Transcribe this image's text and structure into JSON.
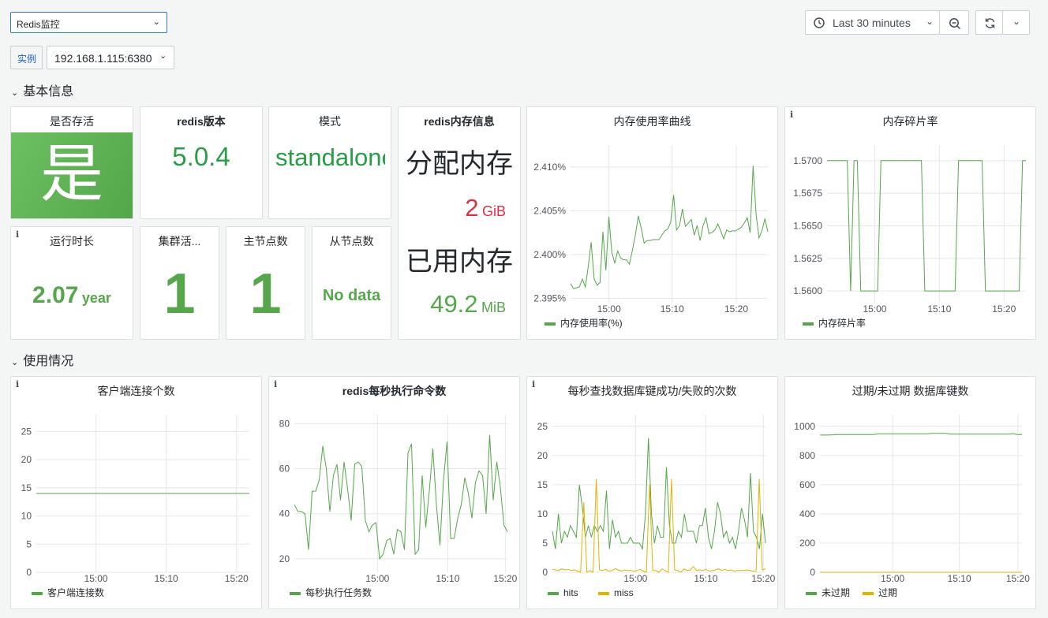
{
  "header": {
    "dashboard_select": "Redis监控",
    "var_label": "实例",
    "var_value": "192.168.1.115:6380",
    "time_range": "Last 30 minutes"
  },
  "rows": {
    "basic": "基本信息",
    "usage": "使用情况"
  },
  "stats": {
    "alive": {
      "title": "是否存活",
      "value": "是"
    },
    "version": {
      "title": "redis版本",
      "value": "5.0.4"
    },
    "mode": {
      "title": "模式",
      "value": "standalone"
    },
    "mem": {
      "title": "redis内存信息",
      "alloc_label": "分配内存",
      "alloc_value": "2",
      "alloc_unit": "GiB",
      "used_label": "已用内存",
      "used_value": "49.2",
      "used_unit": "MiB"
    },
    "uptime": {
      "title": "运行时长",
      "value": "2.07",
      "unit": "year"
    },
    "cluster": {
      "title": "集群活...",
      "value": "1"
    },
    "masters": {
      "title": "主节点数",
      "value": "1"
    },
    "slaves": {
      "title": "从节点数",
      "value": "No data"
    }
  },
  "colors": {
    "green": "#56a64b",
    "yellow": "#e0b400",
    "red": "#e02f44",
    "stat_green": "#299c46"
  },
  "chart_data": [
    {
      "id": "mem_usage",
      "type": "line",
      "title": "内存使用率曲线",
      "x_ticks": [
        "15:00",
        "15:10",
        "15:20"
      ],
      "y_ticks": [
        "2.395%",
        "2.400%",
        "2.405%",
        "2.410%"
      ],
      "ylim": [
        2.3945,
        2.4125
      ],
      "series": [
        {
          "name": "内存使用率(%)",
          "color": "#56a64b",
          "values": [
            2.3967,
            2.3961,
            2.3962,
            2.3963,
            2.3972,
            2.3963,
            2.3986,
            2.4014,
            2.3972,
            2.3965,
            2.3968,
            2.4026,
            2.3982,
            2.4043,
            2.4003,
            2.399,
            2.4004,
            2.3996,
            2.3994,
            2.3994,
            2.3989,
            2.4005,
            2.4022,
            2.4044,
            2.403,
            2.4013,
            2.4016,
            2.4016,
            2.4017,
            2.4017,
            2.4017,
            2.4022,
            2.4027,
            2.4029,
            2.4037,
            2.4068,
            2.4028,
            2.4033,
            2.4052,
            2.4032,
            2.4036,
            2.404,
            2.4022,
            2.4033,
            2.4016,
            2.4033,
            2.4042,
            2.4024,
            2.4025,
            2.4028,
            2.4035,
            2.4027,
            2.4018,
            2.4028,
            2.4026,
            2.4027,
            2.4027,
            2.4029,
            2.4031,
            2.4036,
            2.4042,
            2.4025,
            2.4101,
            2.4046,
            2.4019,
            2.4027,
            2.4041,
            2.4026
          ]
        }
      ]
    },
    {
      "id": "frag",
      "type": "line",
      "title": "内存碎片率",
      "x_ticks": [
        "15:00",
        "15:10",
        "15:20"
      ],
      "y_ticks": [
        "1.5600",
        "1.5625",
        "1.5650",
        "1.5675",
        "1.5700"
      ],
      "ylim": [
        1.5591,
        1.5712
      ],
      "series": [
        {
          "name": "内存碎片率",
          "color": "#56a64b",
          "values": [
            1.57,
            1.57,
            1.57,
            1.57,
            1.57,
            1.57,
            1.57,
            1.56,
            1.57,
            1.57,
            1.56,
            1.56,
            1.56,
            1.56,
            1.56,
            1.56,
            1.57,
            1.57,
            1.57,
            1.57,
            1.57,
            1.57,
            1.57,
            1.57,
            1.57,
            1.57,
            1.57,
            1.57,
            1.57,
            1.56,
            1.56,
            1.56,
            1.56,
            1.56,
            1.56,
            1.56,
            1.56,
            1.56,
            1.56,
            1.57,
            1.57,
            1.57,
            1.57,
            1.57,
            1.57,
            1.57,
            1.57,
            1.56,
            1.56,
            1.56,
            1.56,
            1.56,
            1.56,
            1.56,
            1.56,
            1.56,
            1.56,
            1.56,
            1.57,
            1.57
          ]
        }
      ]
    },
    {
      "id": "clients",
      "type": "line",
      "title": "客户端连接个数",
      "x_ticks": [
        "15:00",
        "15:10",
        "15:20"
      ],
      "y_ticks": [
        "0",
        "5",
        "10",
        "15",
        "20",
        "25"
      ],
      "ylim": [
        0,
        28
      ],
      "series": [
        {
          "name": "客户端连接数",
          "color": "#56a64b",
          "values": [
            14,
            14
          ]
        }
      ]
    },
    {
      "id": "ops",
      "type": "line",
      "title": "redis每秒执行命令数",
      "x_ticks": [
        "15:00",
        "15:10",
        "15:20"
      ],
      "y_ticks": [
        "20",
        "40",
        "60",
        "80"
      ],
      "ylim": [
        14,
        84
      ],
      "series": [
        {
          "name": "每秒执行任务数",
          "color": "#56a64b",
          "values": [
            44,
            41,
            41,
            40,
            24,
            50,
            50,
            55,
            70,
            60,
            41,
            57,
            62,
            46,
            63,
            51,
            37,
            62,
            63,
            61,
            37,
            32,
            35,
            36,
            20,
            22,
            28,
            29,
            22,
            33,
            32,
            24,
            67,
            71,
            22,
            24,
            57,
            34,
            50,
            69,
            44,
            26,
            55,
            72,
            29,
            29,
            38,
            44,
            56,
            49,
            38,
            54,
            59,
            57,
            40,
            75,
            46,
            63,
            52,
            35,
            32
          ]
        }
      ]
    },
    {
      "id": "hits",
      "type": "line",
      "title": "每秒查找数据库键成功/失败的次数",
      "x_ticks": [
        "15:00",
        "15:10",
        "15:20"
      ],
      "y_ticks": [
        "0",
        "5",
        "10",
        "15",
        "20",
        "25"
      ],
      "ylim": [
        0,
        27
      ],
      "series": [
        {
          "name": "hits",
          "color": "#56a64b",
          "values": [
            7,
            4,
            10,
            5,
            7,
            6,
            8,
            7,
            6,
            15,
            11,
            6,
            8,
            6,
            8,
            7,
            8,
            7,
            14,
            4,
            9,
            6,
            7,
            5,
            5,
            5,
            6,
            5,
            5,
            5,
            4,
            10,
            23,
            10,
            5,
            8,
            6,
            6,
            18,
            8,
            5,
            5,
            7,
            6,
            10,
            7,
            7,
            7,
            5,
            8,
            8,
            11,
            6,
            4,
            7,
            12,
            10,
            6,
            7,
            5,
            6,
            4,
            7,
            11,
            9,
            6,
            17,
            7,
            6,
            4,
            10,
            5
          ]
        },
        {
          "name": "miss",
          "color": "#e0b400",
          "values": [
            0.5,
            0.4,
            0.3,
            0.6,
            0.4,
            0.5,
            0.3,
            0.4,
            0.2,
            0,
            12,
            0,
            0.3,
            0,
            16,
            0.4,
            0.3,
            0.5,
            0.2,
            0.3,
            0.6,
            0.4,
            0.2,
            0.4,
            0.3,
            0.3,
            0.2,
            0.3,
            0.5,
            0.2,
            0,
            15,
            0.3,
            0.3,
            0,
            0.6,
            0.3,
            0,
            16,
            0.4,
            0.3,
            0,
            0.6,
            0.3,
            0.4,
            1,
            0.3,
            0.4,
            0.3,
            0.5,
            0.2,
            0.3,
            0.4,
            0.6,
            0.3,
            0.5,
            0.3,
            0.4,
            0.2,
            0.3,
            0.3,
            0.3,
            0.4,
            0.3,
            0.2,
            0.2,
            16,
            0.4,
            0.6
          ]
        }
      ]
    },
    {
      "id": "expire",
      "type": "line",
      "title": "过期/未过期 数据库键数",
      "x_ticks": [
        "15:00",
        "15:10",
        "15:20"
      ],
      "y_ticks": [
        "0",
        "200",
        "400",
        "600",
        "800",
        "1000"
      ],
      "ylim": [
        0,
        1080
      ],
      "series": [
        {
          "name": "未过期",
          "color": "#56a64b",
          "values": [
            940,
            940,
            940,
            942,
            944,
            944,
            944,
            944,
            944,
            944,
            944,
            944,
            944,
            948,
            948,
            948,
            948,
            948,
            948,
            948,
            948,
            948,
            948,
            948,
            948,
            952,
            952,
            952,
            952,
            946,
            946,
            946,
            946,
            946,
            946,
            946,
            946,
            946,
            946,
            946,
            946,
            946,
            946,
            950,
            944,
            944
          ]
        },
        {
          "name": "过期",
          "color": "#e0b400",
          "values": [
            0,
            0
          ]
        }
      ]
    }
  ]
}
